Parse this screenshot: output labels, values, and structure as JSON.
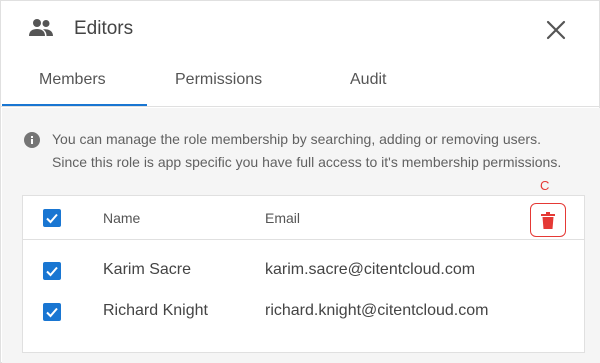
{
  "header": {
    "title": "Editors",
    "icon": "group-icon",
    "close_icon": "close-icon"
  },
  "tabs": [
    {
      "label": "Members",
      "active": true
    },
    {
      "label": "Permissions",
      "active": false
    },
    {
      "label": "Audit",
      "active": false
    }
  ],
  "info": {
    "icon": "info-icon",
    "line1": "You can manage the role membership by searching, adding or removing users.",
    "line2": "Since this role is app specific you have full access to it's membership permissions."
  },
  "annotation_label": "C",
  "table": {
    "select_all_checked": true,
    "columns": {
      "name": "Name",
      "email": "Email"
    },
    "delete_icon": "trash-icon",
    "rows": [
      {
        "checked": true,
        "name": "Karim Sacre",
        "email": "karim.sacre@citentcloud.com"
      },
      {
        "checked": true,
        "name": "Richard Knight",
        "email": "richard.knight@citentcloud.com"
      }
    ]
  },
  "colors": {
    "accent": "#1976d2",
    "danger": "#e53935",
    "background": "#f5f5f5"
  }
}
